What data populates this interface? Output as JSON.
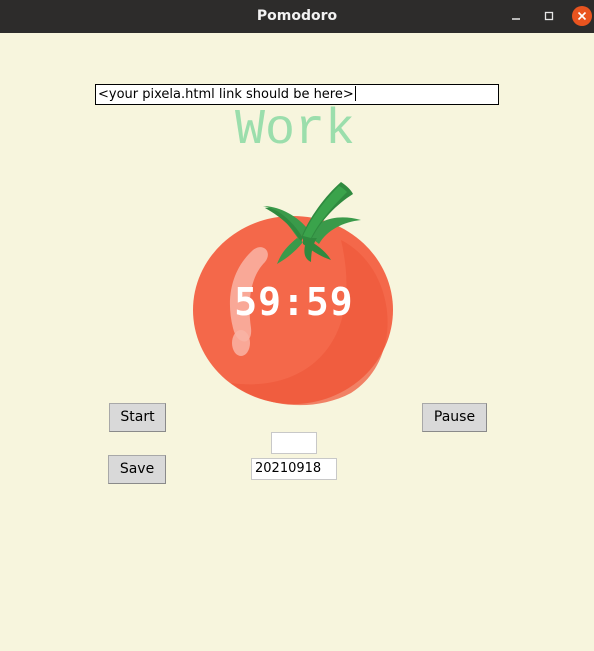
{
  "window": {
    "title": "Pomodoro",
    "controls": {
      "minimize_icon": "minimize-icon",
      "maximize_icon": "maximize-icon",
      "close_icon": "close-icon"
    }
  },
  "link_entry": {
    "value": "<your pixela.html link should be here>"
  },
  "mode_label": "Work",
  "timer": {
    "display": "59:59"
  },
  "buttons": {
    "start": "Start",
    "pause": "Pause",
    "save": "Save"
  },
  "entries": {
    "small_value": "",
    "date_value": "20210918"
  },
  "colors": {
    "background": "#f7f5dd",
    "work_label": "#9bdeac",
    "tomato": "#f4684a",
    "titlebar": "#2d2c2b",
    "close_button": "#e9541f"
  }
}
